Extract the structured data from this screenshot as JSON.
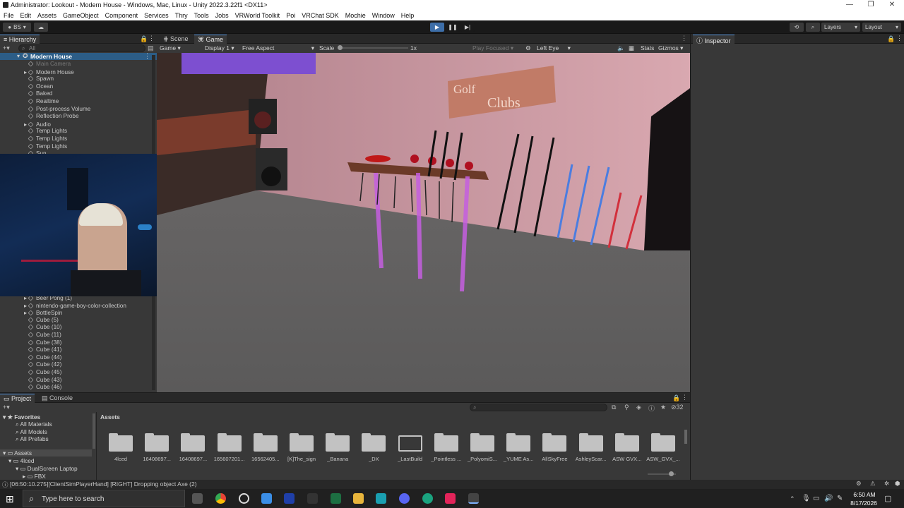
{
  "window": {
    "title": "Administrator: Lookout - Modern House - Windows, Mac, Linux - Unity 2022.3.22f1 <DX11>"
  },
  "menu": [
    "File",
    "Edit",
    "Assets",
    "GameObject",
    "Component",
    "Services",
    "Thry",
    "Tools",
    "Jobs",
    "VRWorld Toolkit",
    "Poi",
    "VRChat SDK",
    "Mochie",
    "Window",
    "Help"
  ],
  "toolbar": {
    "account": "BS",
    "layers": "Layers",
    "layout": "Layout"
  },
  "hierarchy": {
    "tab": "Hierarchy",
    "search_placeholder": "All",
    "scene": "Modern House",
    "items": [
      "Main Camera",
      "Modern House",
      "Spawn",
      "Ocean",
      "Baked",
      "Realtime",
      "Post-process Volume",
      "Reflection Probe",
      "Audio",
      "Temp Lights",
      "Temp Lights",
      "Temp Lights",
      "Sun"
    ],
    "items_bottom": [
      "Beer Pong (1)",
      "nintendo-game-boy-color-collection",
      "BottleSpin",
      "Cube (5)",
      "Cube (10)",
      "Cube (11)",
      "Cube (38)",
      "Cube (41)",
      "Cube (44)",
      "Cube (42)",
      "Cube (45)",
      "Cube (43)",
      "Cube (46)"
    ]
  },
  "game_view": {
    "tabs": [
      "Scene",
      "Game"
    ],
    "mode": "Game",
    "display": "Display 1",
    "aspect": "Free Aspect",
    "scale_label": "Scale",
    "scale_value": "1x",
    "play_focused": "Play Focused",
    "eye": "Left Eye",
    "stats": "Stats",
    "gizmos": "Gizmos",
    "sign_line1": "Golf",
    "sign_line2": "Clubs"
  },
  "inspector": {
    "tab": "Inspector"
  },
  "project": {
    "tabs": [
      "Project",
      "Console"
    ],
    "hidden_count": "32",
    "favorites_label": "Favorites",
    "favorites": [
      "All Materials",
      "All Models",
      "All Prefabs"
    ],
    "assets_root": "Assets",
    "tree": [
      "4lced",
      "DualScreen Laptop",
      "FBX"
    ],
    "breadcrumb": "Assets",
    "folders": [
      "4lced",
      "16408697...",
      "16408697...",
      "165607201...",
      "16562405...",
      "[K]The_sign",
      "_Banana",
      "_DX",
      "_LastBuild",
      "_Pointless ...",
      "_PolyomiS...",
      "_YUME As...",
      "AllSkyFree",
      "AshleyScar...",
      "ASW GVX...",
      "ASW_GVX_..."
    ]
  },
  "status": {
    "message": "[06:50:10.275][ClientSimPlayerHand] [RIGHT] Dropping object Axe (2)"
  },
  "taskbar": {
    "search_placeholder": "Type here to search",
    "time": "6:50 AM",
    "date": "8/17/2026"
  }
}
